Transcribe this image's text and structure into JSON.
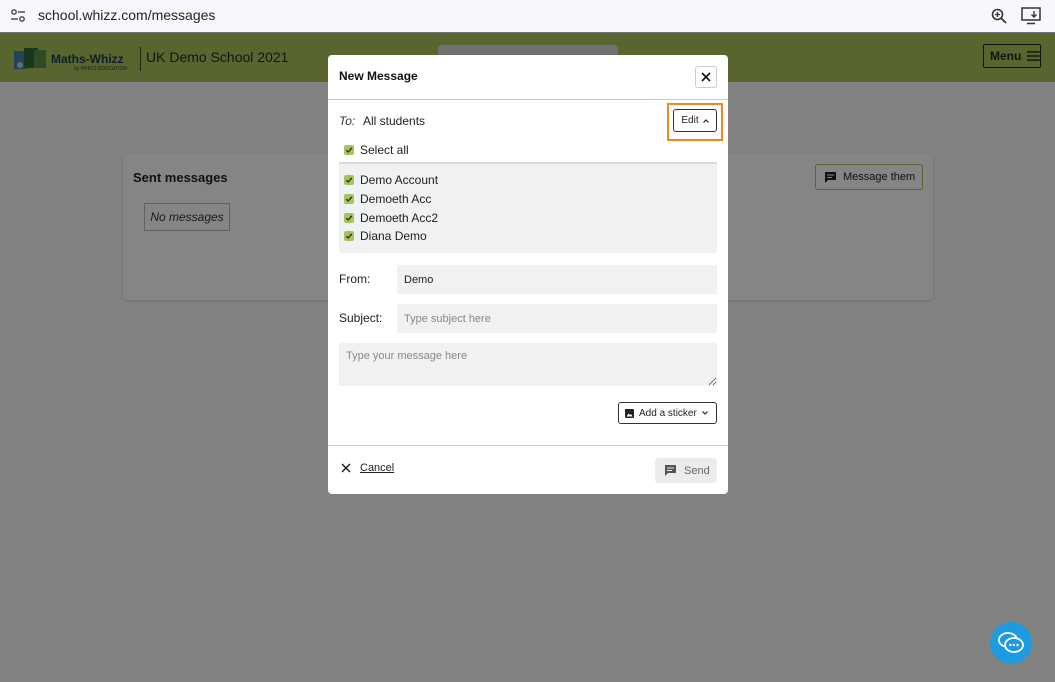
{
  "browser": {
    "url": "school.whizz.com/messages"
  },
  "header": {
    "logo_text": "Maths-Whizz",
    "logo_sub": "by WHIZZ EDUCATION",
    "school_name": "UK Demo School 2021",
    "menu_label": "Menu"
  },
  "page": {
    "sent_title": "Sent messages",
    "no_messages": "No messages",
    "message_them_label": "Message them"
  },
  "modal": {
    "title": "New Message",
    "to_label": "To:",
    "to_value": "All students",
    "edit_label": "Edit",
    "select_all_label": "Select all",
    "recipients": [
      "Demo Account",
      "Demoeth Acc",
      "Demoeth Acc2",
      "Diana Demo"
    ],
    "from_label": "From:",
    "from_value": "Demo",
    "subject_label": "Subject:",
    "subject_placeholder": "Type subject here",
    "message_placeholder": "Type your message here",
    "sticker_label": "Add a sticker",
    "cancel_label": "Cancel",
    "send_label": "Send"
  },
  "colors": {
    "brand_green": "#a9c25a",
    "highlight_orange": "#f08a18",
    "chat_blue": "#1e9be0"
  }
}
